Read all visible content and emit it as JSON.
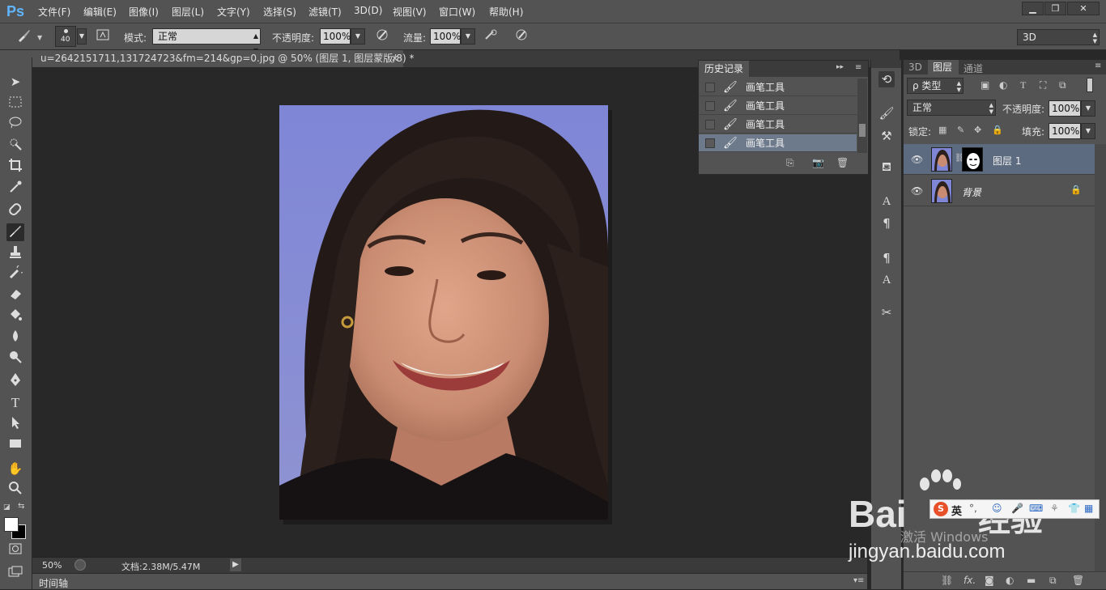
{
  "app": {
    "logo": "Ps"
  },
  "menu": [
    "文件(F)",
    "编辑(E)",
    "图像(I)",
    "图层(L)",
    "文字(Y)",
    "选择(S)",
    "滤镜(T)",
    "3D(D)",
    "视图(V)",
    "窗口(W)",
    "帮助(H)"
  ],
  "window_controls": {
    "minimize": "▁",
    "restore": "❐",
    "close": "✕"
  },
  "options": {
    "brush_size": "40",
    "mode_label": "模式:",
    "mode_value": "正常",
    "opacity_label": "不透明度:",
    "opacity_value": "100%",
    "flow_label": "流量:",
    "flow_value": "100%",
    "workspace": "3D"
  },
  "document": {
    "tab_title": "u=2642151711,131724723&fm=214&gp=0.jpg @ 50% (图层 1, 图层蒙版/8) *",
    "zoom": "50%",
    "doc_info": "文档:2.38M/5.47M"
  },
  "timeline": {
    "label": "时间轴"
  },
  "history": {
    "title": "历史记录",
    "items": [
      "画笔工具",
      "画笔工具",
      "画笔工具",
      "画笔工具"
    ]
  },
  "layers_panel": {
    "tabs": [
      "3D",
      "图层",
      "通道"
    ],
    "filter_label": "ρ 类型",
    "blend_mode": "正常",
    "opacity_label": "不透明度:",
    "opacity_value": "100%",
    "lock_label": "锁定:",
    "fill_label": "填充:",
    "fill_value": "100%",
    "layers": [
      {
        "name": "图层 1"
      },
      {
        "name": "背景"
      }
    ]
  },
  "watermark": {
    "brand": "Bai",
    "brand2": "经验",
    "url": "jingyan.baidu.com",
    "windows": "激活 Windows",
    "ime": "英"
  },
  "colors": {
    "ui_dark": "#535353",
    "canvas_bg": "#282828",
    "selection": "#5d6b80",
    "ps_blue": "#5fb5ff"
  }
}
